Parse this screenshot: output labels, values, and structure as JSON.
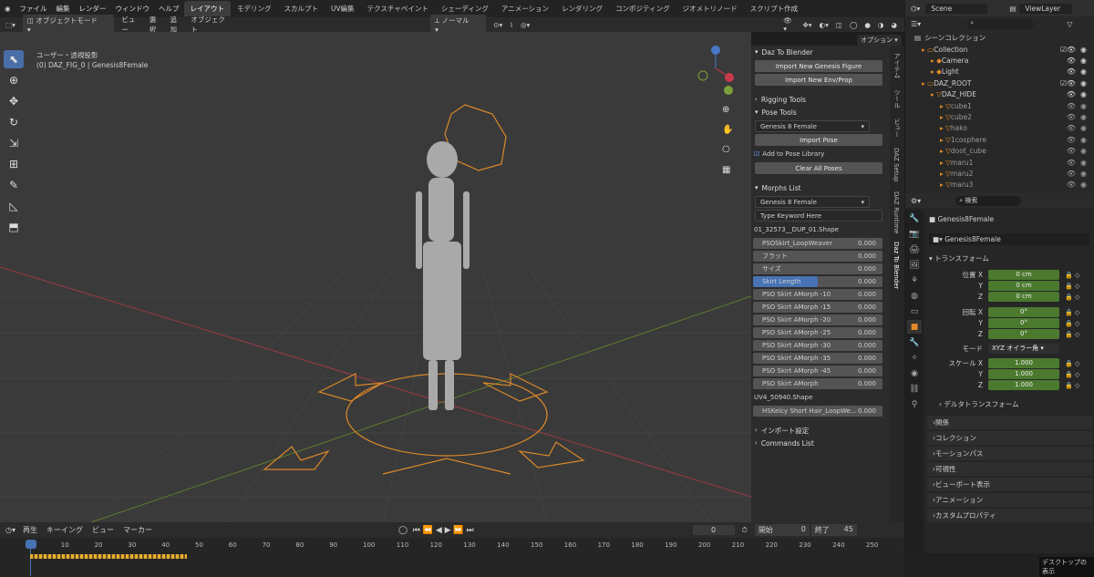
{
  "menu": [
    "ファイル",
    "編集",
    "レンダー",
    "ウィンドウ",
    "ヘルプ"
  ],
  "workspaces": [
    "レイアウト",
    "モデリング",
    "スカルプト",
    "UV編集",
    "テクスチャペイント",
    "シェーディング",
    "アニメーション",
    "レンダリング",
    "コンポジティング",
    "ジオメトリノード",
    "スクリプト作成"
  ],
  "scene": "Scene",
  "viewlayer": "ViewLayer",
  "viewport": {
    "mode": "オブジェクトモード",
    "menus": [
      "ビュー",
      "選択",
      "追加",
      "オブジェクト"
    ],
    "orientation": "ノーマル",
    "view_name": "ユーザー・透視投影",
    "object_info": "(0) DAZ_FIG_0 | Genesis8Female",
    "options": "オプション"
  },
  "npanel": {
    "daz_title": "Daz To Blender",
    "import_figure": "Import New Genesis Figure",
    "import_env": "Import New Env/Prop",
    "rigging": "Rigging Tools",
    "pose": "Pose Tools",
    "figure_select": "Genesis 8 Female",
    "import_pose": "Import Pose",
    "add_pose_lib": "Add to Pose Library",
    "clear_poses": "Clear All Poses",
    "morphs": "Morphs List",
    "morph_select": "Genesis 8 Female",
    "keyword": "Type Keyword Here",
    "shape1": "01_32573__DUP_01.Shape",
    "morph_rows": [
      {
        "name": "PSOSkirt_LoopWeaver",
        "value": "0.000",
        "fill": 0
      },
      {
        "name": "フラット",
        "value": "0.000",
        "fill": 0
      },
      {
        "name": "サイズ",
        "value": "0.000",
        "fill": 0
      },
      {
        "name": "Skirt Length",
        "value": "0.000",
        "fill": 0.5
      },
      {
        "name": "PSO Skirt AMorph -10",
        "value": "0.000",
        "fill": 0
      },
      {
        "name": "PSO Skirt AMorph -15",
        "value": "0.000",
        "fill": 0
      },
      {
        "name": "PSO Skirt AMorph -20",
        "value": "0.000",
        "fill": 0
      },
      {
        "name": "PSO Skirt AMorph -25",
        "value": "0.000",
        "fill": 0
      },
      {
        "name": "PSO Skirt AMorph -30",
        "value": "0.000",
        "fill": 0
      },
      {
        "name": "PSO Skirt AMorph -35",
        "value": "0.000",
        "fill": 0
      },
      {
        "name": "PSO Skirt AMorph -45",
        "value": "0.000",
        "fill": 0
      },
      {
        "name": "PSO Skirt AMorph",
        "value": "0.000",
        "fill": 0
      }
    ],
    "shape2": "UV4_50940.Shape",
    "hair_row": {
      "name": "HSKelcy Short Hair_LoopWe...",
      "value": "0.000"
    },
    "import_settings": "インポート設定",
    "commands": "Commands List"
  },
  "ntabs": [
    "アイテム",
    "ツール",
    "ビュー",
    "DAZ Setup",
    "DAZ Runtime",
    "Daz To Blender"
  ],
  "outliner": {
    "search": "",
    "title": "シーンコレクション",
    "items": [
      {
        "label": "Collection",
        "level": 0
      },
      {
        "label": "Camera",
        "level": 1
      },
      {
        "label": "Light",
        "level": 1
      },
      {
        "label": "DAZ_ROOT",
        "level": 0
      },
      {
        "label": "DAZ_HIDE",
        "level": 1
      },
      {
        "label": "cube1",
        "level": 2
      },
      {
        "label": "cube2",
        "level": 2
      },
      {
        "label": "hako",
        "level": 2
      },
      {
        "label": "1cosphere",
        "level": 2
      },
      {
        "label": "doot_cube",
        "level": 2
      },
      {
        "label": "maru1",
        "level": 2
      },
      {
        "label": "maru2",
        "level": 2
      },
      {
        "label": "maru3",
        "level": 2
      }
    ]
  },
  "props": {
    "search": "検索",
    "object": "Genesis8Female",
    "object_field": "Genesis8Female",
    "transform": "トランスフォーム",
    "loc_label": "位置 X",
    "rot_label": "回転 X",
    "scale_label": "スケール X",
    "y": "Y",
    "z": "Z",
    "loc": [
      "0 cm",
      "0 cm",
      "0 cm"
    ],
    "rot": [
      "0°",
      "0°",
      "0°"
    ],
    "scale": [
      "1.000",
      "1.000",
      "1.000"
    ],
    "mode_label": "モード",
    "mode": "XYZ オイラー角",
    "delta": "デルタトランスフォーム",
    "sections": [
      "関係",
      "コレクション",
      "モーションパス",
      "可視性",
      "ビューポート表示",
      "アニメーション",
      "カスタムプロパティ"
    ]
  },
  "timeline": {
    "menus": [
      "再生",
      "キーイング",
      "ビュー",
      "マーカー"
    ],
    "current": "0",
    "start_label": "開始",
    "start": "0",
    "end_label": "終了",
    "end": "45",
    "ticks": [
      "0",
      "10",
      "20",
      "30",
      "40",
      "50",
      "60",
      "70",
      "80",
      "90",
      "100",
      "110",
      "120",
      "130",
      "140",
      "150",
      "160",
      "170",
      "180",
      "190",
      "200",
      "210",
      "220",
      "230",
      "240",
      "250"
    ]
  },
  "status": "デスクトップの表示"
}
